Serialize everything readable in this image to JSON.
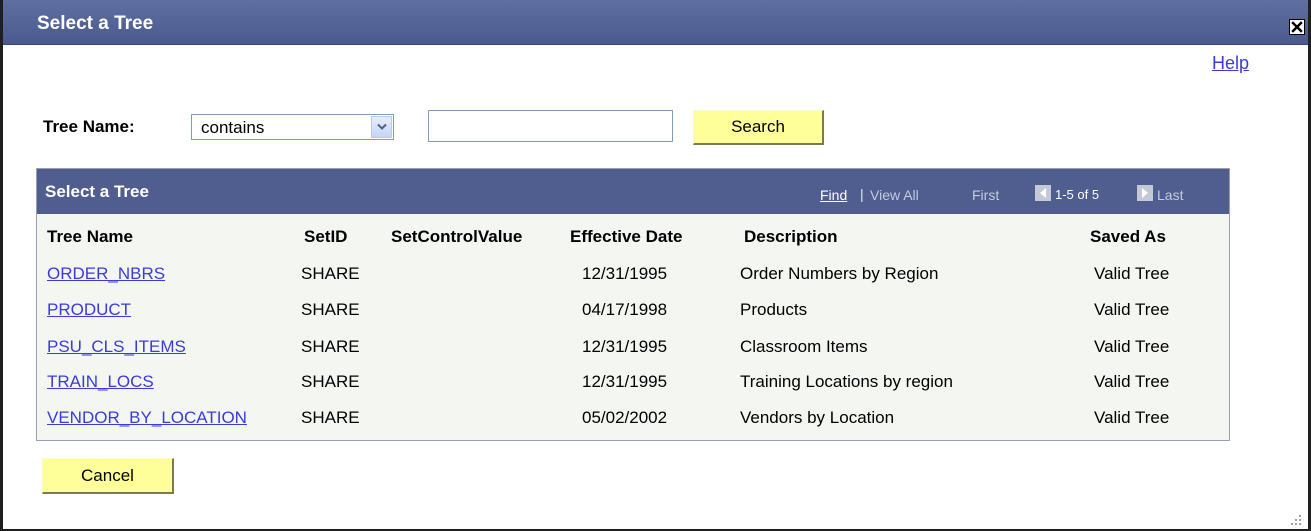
{
  "window": {
    "title": "Select a Tree"
  },
  "help": {
    "label": "Help"
  },
  "search": {
    "field_label": "Tree Name:",
    "operator": "contains",
    "query": "",
    "button_label": "Search"
  },
  "grid": {
    "title": "Select a Tree",
    "find_label": "Find",
    "separator": "|",
    "view_all_label": "View All",
    "first_label": "First",
    "range_label": "1-5 of 5",
    "last_label": "Last",
    "columns": [
      "Tree Name",
      "SetID",
      "SetControlValue",
      "Effective Date",
      "Description",
      "Saved As"
    ],
    "rows": [
      {
        "tree_name": "ORDER_NBRS",
        "setid": "SHARE",
        "setcontrolvalue": "",
        "effective_date": "12/31/1995",
        "description": "Order Numbers by Region",
        "saved_as": "Valid Tree"
      },
      {
        "tree_name": "PRODUCT",
        "setid": "SHARE",
        "setcontrolvalue": "",
        "effective_date": "04/17/1998",
        "description": "Products",
        "saved_as": "Valid Tree"
      },
      {
        "tree_name": "PSU_CLS_ITEMS",
        "setid": "SHARE",
        "setcontrolvalue": "",
        "effective_date": "12/31/1995",
        "description": "Classroom Items",
        "saved_as": "Valid Tree"
      },
      {
        "tree_name": "TRAIN_LOCS",
        "setid": "SHARE",
        "setcontrolvalue": "",
        "effective_date": "12/31/1995",
        "description": "Training Locations by region",
        "saved_as": "Valid Tree"
      },
      {
        "tree_name": "VENDOR_BY_LOCATION",
        "setid": "SHARE",
        "setcontrolvalue": "",
        "effective_date": "05/02/2002",
        "description": "Vendors by Location",
        "saved_as": "Valid Tree"
      }
    ]
  },
  "cancel": {
    "label": "Cancel"
  },
  "colors": {
    "titlebar": "#4a5a8c",
    "grid_header": "#4f5d8f",
    "grid_body": "#f4f6f1",
    "button_face": "#ffff99",
    "link": "#3b3bd9"
  },
  "icons": {
    "close": "close-icon",
    "dropdown": "chevron-down-icon",
    "prev": "prev-page-icon",
    "next": "next-page-icon",
    "grip": "resize-grip-icon"
  }
}
